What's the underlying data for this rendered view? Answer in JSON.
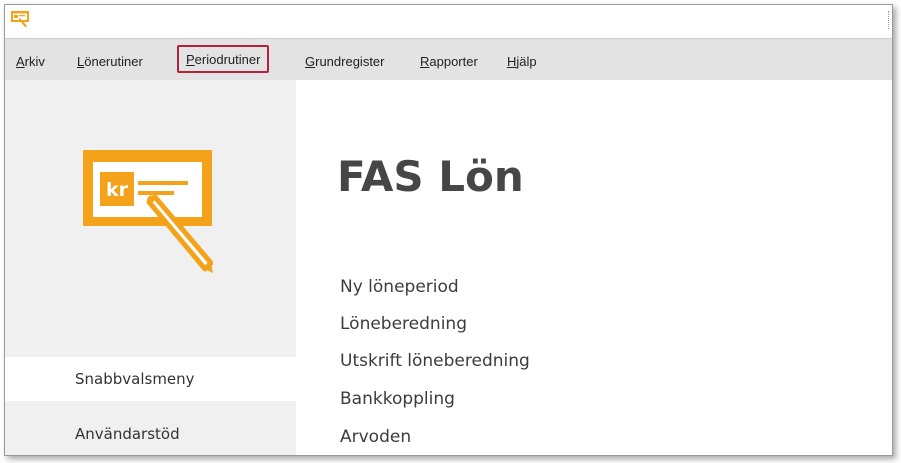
{
  "titlebar": {
    "icon": "fas-lon-app-icon"
  },
  "menu": [
    {
      "mnemonic": "A",
      "rest": "rkiv"
    },
    {
      "mnemonic": "L",
      "rest": "önerutiner"
    },
    {
      "mnemonic": "P",
      "rest": "eriodrutiner"
    },
    {
      "mnemonic": "G",
      "rest": "rundregister"
    },
    {
      "mnemonic": "R",
      "rest": "apporter"
    },
    {
      "mnemonic": "H",
      "rest": "jälp"
    }
  ],
  "sidebar": {
    "logo_text": "kr",
    "items": [
      {
        "label": "Snabbvalsmeny"
      },
      {
        "label": "Användarstöd"
      }
    ]
  },
  "main": {
    "title": "FAS Lön",
    "links": [
      {
        "label": "Ny löneperiod"
      },
      {
        "label": "Löneberedning"
      },
      {
        "label": "Utskrift löneberedning"
      },
      {
        "label": "Bankkoppling"
      },
      {
        "label": "Arvoden"
      }
    ]
  },
  "colors": {
    "accent": "#f5a21b",
    "highlight_border": "#b3213f"
  }
}
